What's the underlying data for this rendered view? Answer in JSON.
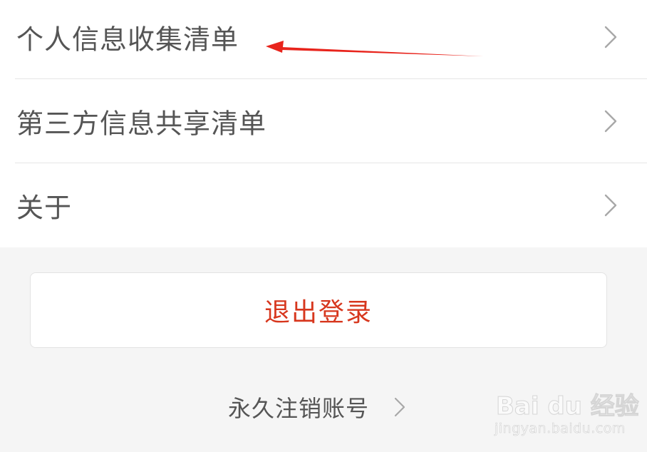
{
  "menu": {
    "items": [
      {
        "label": "个人信息收集清单"
      },
      {
        "label": "第三方信息共享清单"
      },
      {
        "label": "关于"
      }
    ]
  },
  "logout": {
    "label": "退出登录"
  },
  "delete_account": {
    "label": "永久注销账号"
  },
  "watermark": {
    "logo": "Bai du 经验",
    "url": "jingyan.baidu.com"
  },
  "colors": {
    "logout_text": "#d7371e",
    "annotation_arrow": "#e8241c",
    "row_text": "#555555",
    "page_bg": "#f5f5f5"
  },
  "icons": {
    "row_chevron": "chevron-right-icon",
    "annotation": "red-arrow-icon"
  }
}
